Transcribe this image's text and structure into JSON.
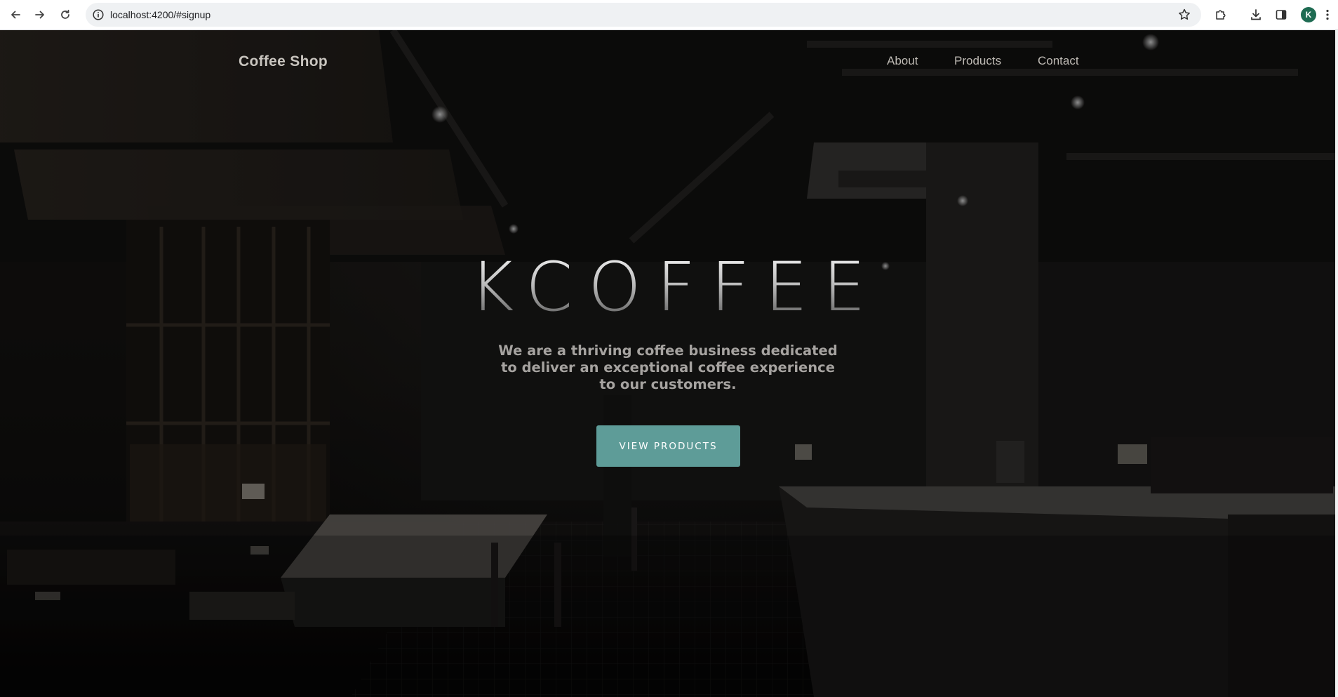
{
  "browser": {
    "url": "localhost:4200/#signup",
    "profile_initial": "K",
    "profile_color": "#1e6b52"
  },
  "site": {
    "brand": "Coffee Shop",
    "nav": [
      {
        "label": "About"
      },
      {
        "label": "Products"
      },
      {
        "label": "Contact"
      }
    ]
  },
  "hero": {
    "title": "KCOFFEE",
    "subtitle": "We are a thriving coffee business dedicated to deliver an exceptional coffee experience to our customers.",
    "cta_label": "VIEW PRODUCTS",
    "cta_color": "#5e9c98"
  }
}
